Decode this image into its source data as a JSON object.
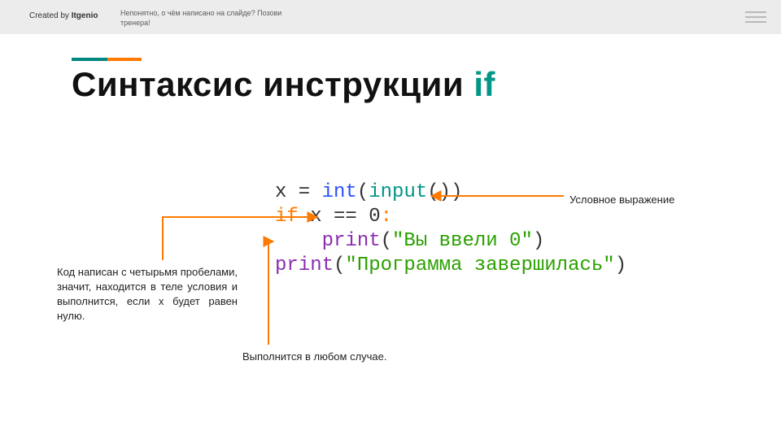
{
  "header": {
    "created_prefix": "Created by ",
    "brand": "Itgenio",
    "helper_text": "Непонятно, о чём написано на слайде? Позови тренера!"
  },
  "title": {
    "main": "Синтаксис инструкции",
    "keyword": "if"
  },
  "code": {
    "line1": {
      "lhs": "x = ",
      "fn": "int",
      "paren1": "(",
      "inp": "input",
      "paren2": "())"
    },
    "line2": {
      "kw": "if",
      "expr": " x == 0",
      "colon": ":"
    },
    "line3": {
      "indent": "    ",
      "call": "print",
      "paren_open": "(",
      "str": "\"Вы ввели 0\"",
      "paren_close": ")"
    },
    "line4": {
      "call": "print",
      "paren_open": "(",
      "str": "\"Программа завершилась\"",
      "paren_close": ")"
    }
  },
  "annotations": {
    "left": "Код написан с четырьмя пробелами, значит, находится в теле условия и выполнится, если x будет равен нулю.",
    "bottom": "Выполнится в любом случае.",
    "right": "Условное выражение"
  },
  "colors": {
    "teal": "#009688",
    "orange": "#ff7a00"
  }
}
